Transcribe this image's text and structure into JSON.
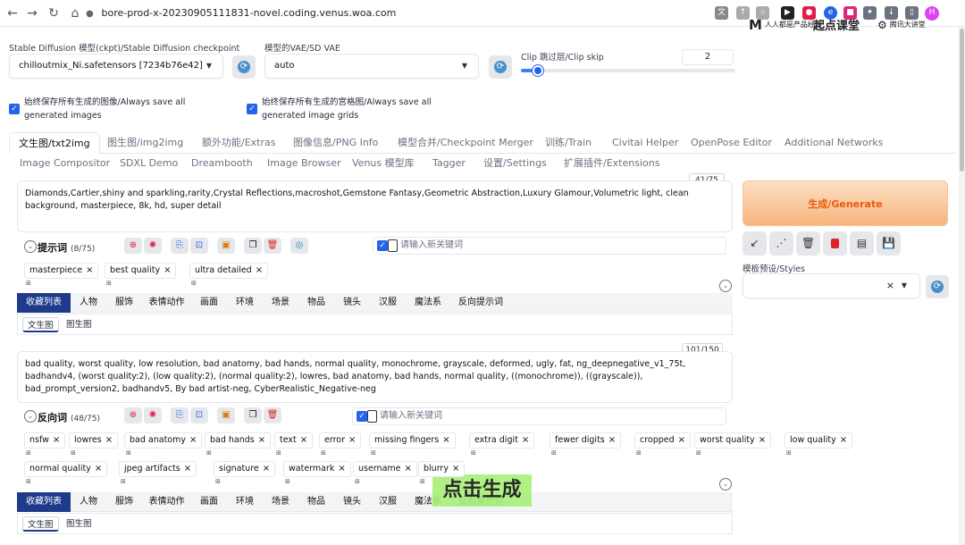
{
  "browser": {
    "url": "bore-prod-x-20230905111831-novel.coding.venus.woa.com",
    "profile_letter": "H",
    "watermarks": [
      "人人都是产品经理",
      "起点课堂",
      "腾讯大讲堂"
    ]
  },
  "top": {
    "checkpoint_label": "Stable Diffusion 模型(ckpt)/Stable Diffusion checkpoint",
    "checkpoint_value": "chilloutmix_Ni.safetensors [7234b76e42]",
    "vae_label": "模型的VAE/SD VAE",
    "vae_value": "auto",
    "clip_label": "Clip 跳过层/Clip skip",
    "clip_value": "2",
    "clip_fraction": 0.08,
    "save_images": "始终保存所有生成的图像/Always save all generated images",
    "save_grids": "始终保存所有生成的宫格图/Always save all generated image grids"
  },
  "tabs_row1": [
    "文生图/txt2img",
    "图生图/img2img",
    "额外功能/Extras",
    "图像信息/PNG Info",
    "模型合并/Checkpoint Merger",
    "训练/Train",
    "Civitai Helper",
    "OpenPose Editor",
    "Additional Networks"
  ],
  "tabs_row2": [
    "Image Compositor",
    "SDXL Demo",
    "Dreambooth",
    "Image Browser",
    "Venus 模型库",
    "Tagger",
    "设置/Settings",
    "扩展插件/Extensions"
  ],
  "prompt": {
    "counter": "41/75",
    "text": "Diamonds,Cartier,shiny and sparkling,rarity,Crystal Reflections,macroshot,Gemstone Fantasy,Geometric Abstraction,Luxury Glamour,Volumetric light, clean background, masterpiece,  8k, hd, super detail",
    "title": "提示词",
    "count": "(8/75)",
    "placeholder": "请输入新关键词",
    "chips": [
      "masterpiece",
      "best quality",
      "ultra detailed"
    ],
    "chip_sub": "⊞"
  },
  "category_tabs": [
    "收藏列表",
    "人物",
    "服饰",
    "表情动作",
    "画面",
    "环境",
    "场景",
    "物品",
    "镜头",
    "汉服",
    "魔法系",
    "反向提示词"
  ],
  "sub_tabs": [
    "文生图",
    "图生图"
  ],
  "negative": {
    "counter": "101/150",
    "text": "bad quality, worst quality, low resolution, bad anatomy, bad hands, normal quality, monochrome, grayscale, deformed, ugly, fat, ng_deepnegative_v1_75t, badhandv4, (worst quality:2), (low quality:2), (normal quality:2), lowres, bad anatomy, bad hands, normal quality, ((monochrome)), ((grayscale)), bad_prompt_version2, badhandv5, By bad artist-neg, CyberRealistic_Negative-neg",
    "title": "反向词",
    "count": "(48/75)",
    "placeholder": "请输入新关键词",
    "chips_row1": [
      "nsfw",
      "lowres",
      "bad anatomy",
      "bad hands",
      "text",
      "error",
      "missing fingers",
      "extra digit",
      "fewer digits",
      "cropped",
      "worst quality",
      "low quality"
    ],
    "chips_row2": [
      "normal quality",
      "jpeg artifacts",
      "signature",
      "watermark",
      "username",
      "blurry"
    ]
  },
  "right": {
    "generate_label": "生成/Generate",
    "styles_label": "模板预设/Styles",
    "clear_x": "×"
  },
  "caption": "点击生成",
  "icons": {
    "back": "←",
    "forward": "→",
    "reload": "↻",
    "home": "⌂",
    "lock": "🔒",
    "emoji": "☺",
    "refresh": "⟳",
    "translate": "文"
  }
}
